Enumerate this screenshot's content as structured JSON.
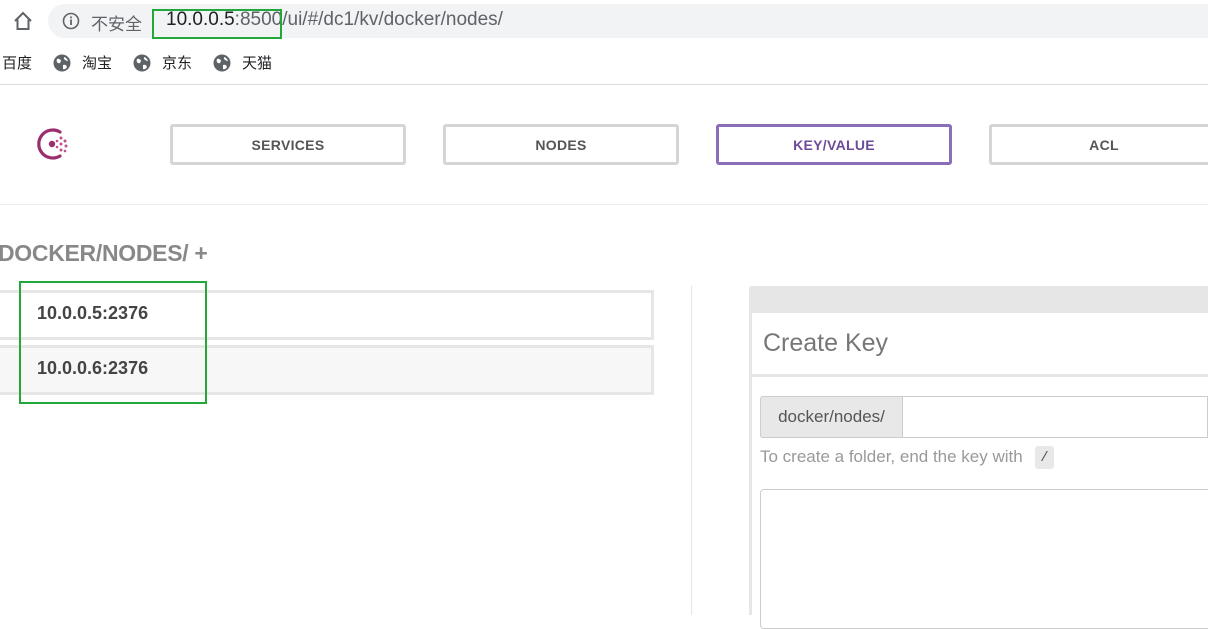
{
  "browser": {
    "insecure_label": "不安全",
    "url_host": "10.0.0.5",
    "url_port": ":8500",
    "url_path": "/ui/#/dc1/kv/docker/nodes/",
    "bookmarks": [
      {
        "label": "百度",
        "icon": "none"
      },
      {
        "label": "淘宝",
        "icon": "globe-icon"
      },
      {
        "label": "京东",
        "icon": "globe-icon"
      },
      {
        "label": "天猫",
        "icon": "globe-icon"
      }
    ]
  },
  "nav": {
    "logo": "consul-logo",
    "items": [
      {
        "label": "SERVICES",
        "active": false
      },
      {
        "label": "NODES",
        "active": false
      },
      {
        "label": "KEY/VALUE",
        "active": true
      },
      {
        "label": "ACL",
        "active": false
      }
    ]
  },
  "kv": {
    "title": "DOCKER/NODES/ +",
    "keys": [
      "10.0.0.5:2376",
      "10.0.0.6:2376"
    ]
  },
  "create_key": {
    "title": "Create Key",
    "prefix": "docker/nodes/",
    "key_value": "",
    "help_text": "To create a folder, end the key with",
    "help_code": "/",
    "value": ""
  },
  "colors": {
    "accent": "#8b6eb8",
    "highlight": "#22a83a",
    "logo": "#9b2e6e"
  }
}
